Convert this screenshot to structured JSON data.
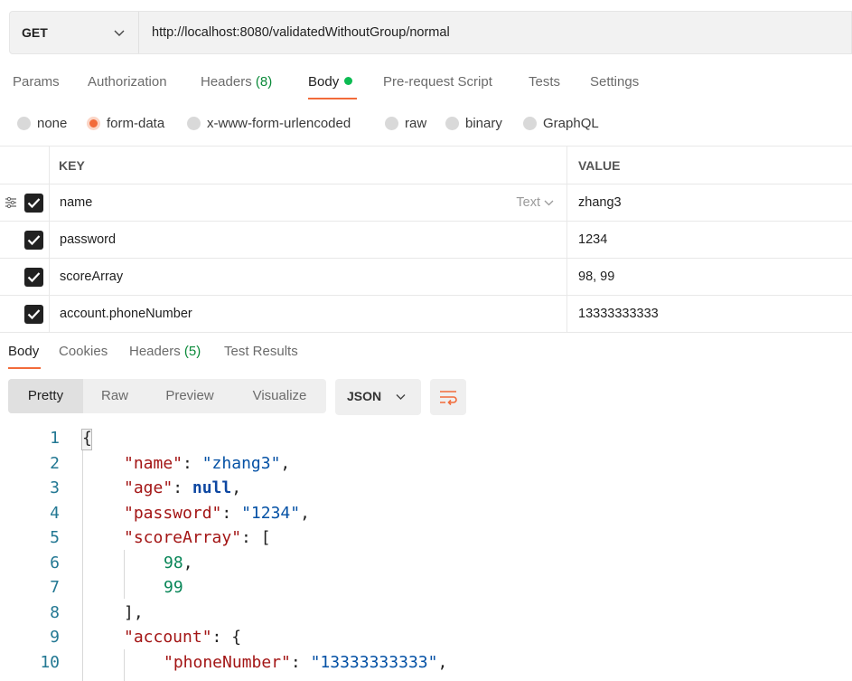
{
  "request": {
    "method": "GET",
    "url": "http://localhost:8080/validatedWithoutGroup/normal"
  },
  "request_tabs": {
    "params": "Params",
    "authorization": "Authorization",
    "headers": "Headers",
    "headers_count": "(8)",
    "body": "Body",
    "prerequest": "Pre-request Script",
    "tests": "Tests",
    "settings": "Settings"
  },
  "body_types": {
    "none": "none",
    "form_data": "form-data",
    "urlencoded": "x-www-form-urlencoded",
    "raw": "raw",
    "binary": "binary",
    "graphql": "GraphQL"
  },
  "kv_table": {
    "key_header": "KEY",
    "value_header": "VALUE",
    "type_label": "Text",
    "rows": [
      {
        "key": "name",
        "value": "zhang3"
      },
      {
        "key": "password",
        "value": "1234"
      },
      {
        "key": "scoreArray",
        "value": "98, 99"
      },
      {
        "key": "account.phoneNumber",
        "value": "13333333333"
      }
    ]
  },
  "response_tabs": {
    "body": "Body",
    "cookies": "Cookies",
    "headers": "Headers",
    "headers_count": "(5)",
    "test_results": "Test Results"
  },
  "view_modes": {
    "pretty": "Pretty",
    "raw": "Raw",
    "preview": "Preview",
    "visualize": "Visualize",
    "format": "JSON"
  },
  "code": {
    "line_numbers": [
      "1",
      "2",
      "3",
      "4",
      "5",
      "6",
      "7",
      "8",
      "9",
      "10"
    ],
    "lines": {
      "l1_open": "{",
      "l2_key": "\"name\"",
      "l2_val": "\"zhang3\"",
      "l3_key": "\"age\"",
      "l3_val": "null",
      "l4_key": "\"password\"",
      "l4_val": "\"1234\"",
      "l5_key": "\"scoreArray\"",
      "l5_open": "[",
      "l6_val": "98",
      "l7_val": "99",
      "l8_close": "]",
      "l9_key": "\"account\"",
      "l9_open": "{",
      "l10_key": "\"phoneNumber\"",
      "l10_val": "\"13333333333\""
    }
  }
}
